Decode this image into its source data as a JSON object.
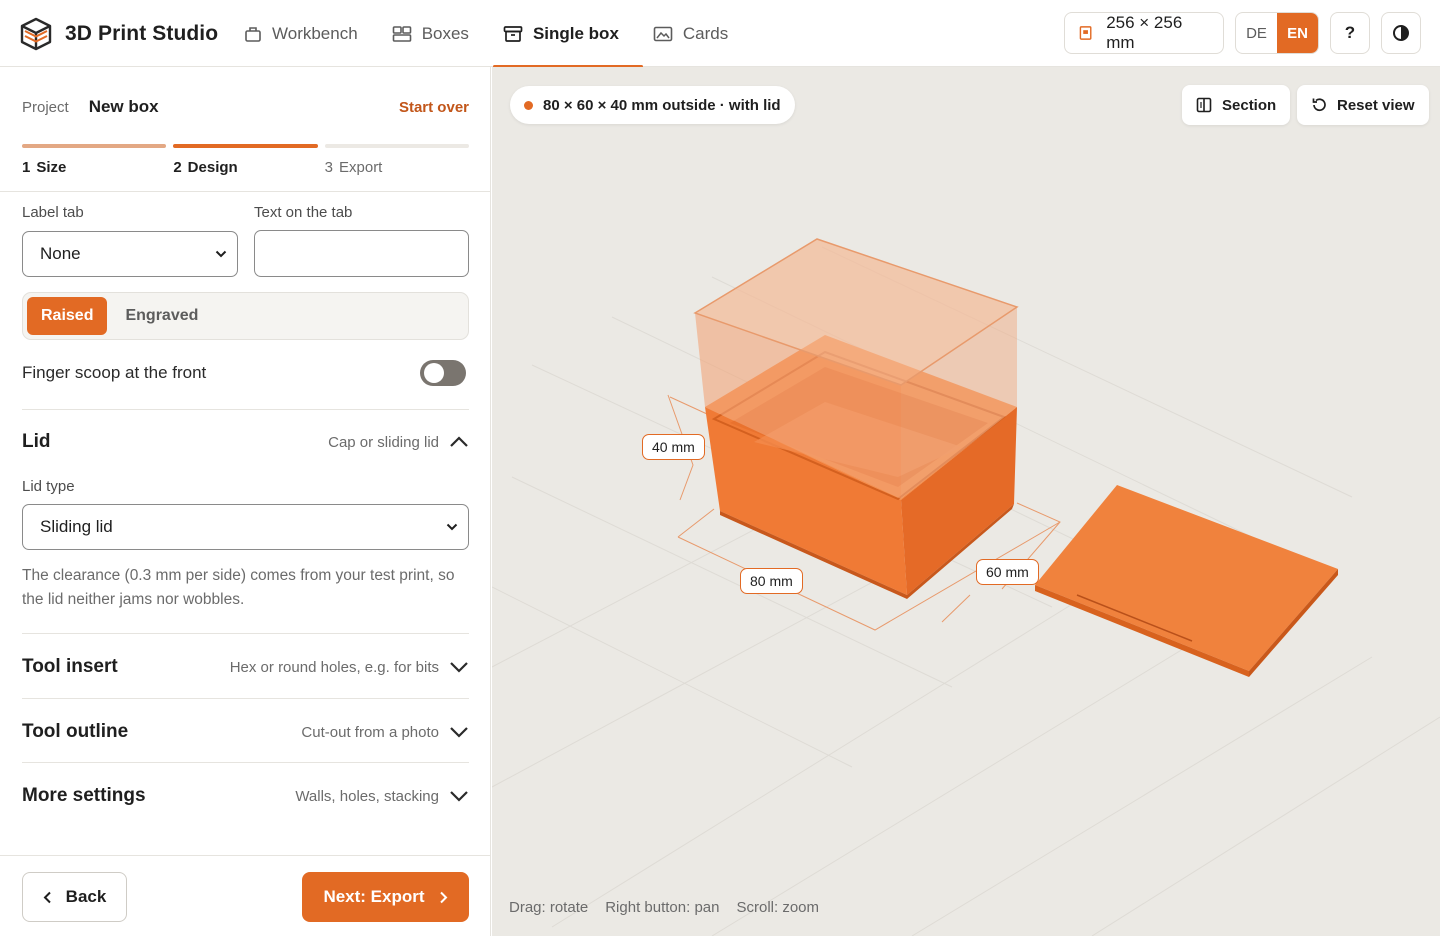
{
  "app": {
    "title": "3D Print Studio",
    "logo_icon": "box-logo-icon"
  },
  "nav": {
    "items": [
      {
        "label": "Workbench",
        "icon": "workbench-icon",
        "active": false
      },
      {
        "label": "Boxes",
        "icon": "boxes-icon",
        "active": false
      },
      {
        "label": "Single box",
        "icon": "single-box-icon",
        "active": true
      },
      {
        "label": "Cards",
        "icon": "cards-icon",
        "active": false
      }
    ]
  },
  "toolbar": {
    "bed_size": "256 × 256 mm",
    "languages": [
      "DE",
      "EN"
    ],
    "active_language": "EN",
    "help_label": "?",
    "theme_icon": "contrast-icon"
  },
  "project": {
    "label": "Project",
    "name": "New box",
    "start_over": "Start over"
  },
  "steps": [
    {
      "num": "1",
      "label": "Size",
      "state": "done"
    },
    {
      "num": "2",
      "label": "Design",
      "state": "active"
    },
    {
      "num": "3",
      "label": "Export",
      "state": "future"
    }
  ],
  "label_tab": {
    "label": "Label tab",
    "value": "None"
  },
  "tab_text": {
    "label": "Text on the tab",
    "value": ""
  },
  "text_style": {
    "options": [
      "Raised",
      "Engraved"
    ],
    "selected": "Raised"
  },
  "finger_scoop": {
    "label": "Finger scoop at the front",
    "enabled": false
  },
  "sections": {
    "lid": {
      "title": "Lid",
      "hint": "Cap or sliding lid",
      "expanded": true
    },
    "tool_insert": {
      "title": "Tool insert",
      "hint": "Hex or round holes, e.g. for bits",
      "expanded": false
    },
    "tool_outline": {
      "title": "Tool outline",
      "hint": "Cut-out from a photo",
      "expanded": false
    },
    "more_settings": {
      "title": "More settings",
      "hint": "Walls, holes, stacking",
      "expanded": false
    }
  },
  "lid_type": {
    "label": "Lid type",
    "value": "Sliding lid"
  },
  "clearance_note": "The clearance (0.3 mm per side) comes from your test print, so the lid neither jams nor wobbles.",
  "footer": {
    "back": "Back",
    "next": "Next: Export"
  },
  "viewport": {
    "info": "80 × 60 × 40 mm outside · with lid",
    "section_button": "Section",
    "reset_button": "Reset view",
    "dimensions": {
      "height": "40 mm",
      "width": "80 mm",
      "depth": "60 mm"
    },
    "hints": [
      "Drag: rotate",
      "Right button: pan",
      "Scroll: zoom"
    ]
  },
  "colors": {
    "accent": "#e26a24",
    "accent_dark": "#c2561a",
    "viewport_bg": "#ebe9e4",
    "box": "#f07a35"
  }
}
